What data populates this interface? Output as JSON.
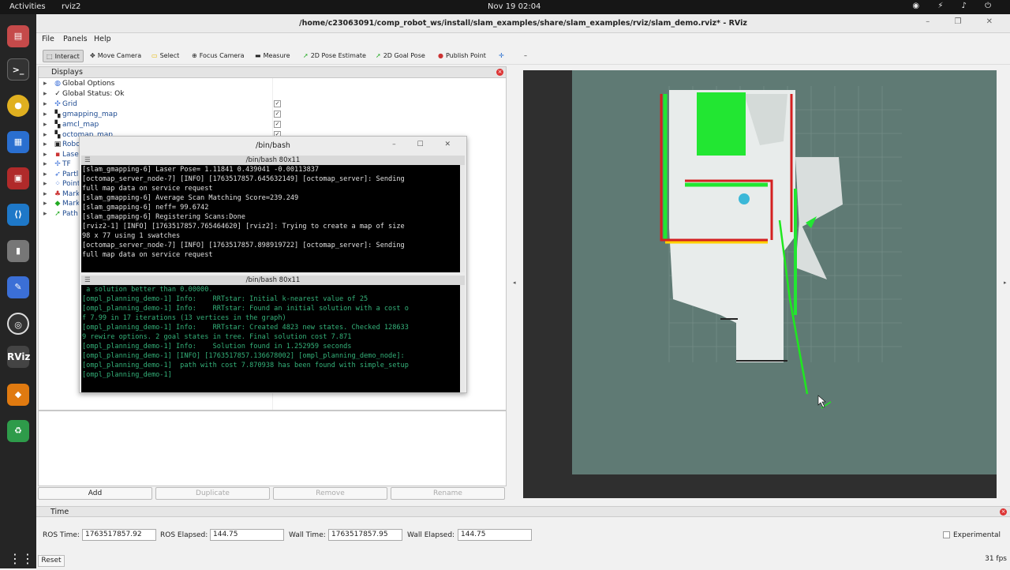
{
  "topbar": {
    "activities": "Activities",
    "app_name": "rviz2",
    "clock": "Nov 19  02:04"
  },
  "window": {
    "title": "/home/c23063091/comp_robot_ws/install/slam_examples/share/slam_examples/rviz/slam_demo.rviz* - RViz"
  },
  "menu": {
    "file": "File",
    "panels": "Panels",
    "help": "Help"
  },
  "toolbar": {
    "interact": "Interact",
    "move_camera": "Move Camera",
    "select": "Select",
    "focus_camera": "Focus Camera",
    "measure": "Measure",
    "pose_estimate": "2D Pose Estimate",
    "goal_pose": "2D Goal Pose",
    "publish_point": "Publish Point"
  },
  "displays": {
    "title": "Displays",
    "items": [
      {
        "label": "Global Options"
      },
      {
        "label": "Global Status: Ok"
      },
      {
        "label": "Grid",
        "checked": true
      },
      {
        "label": "gmapping_map",
        "checked": true
      },
      {
        "label": "amcl_map",
        "checked": true
      },
      {
        "label": "octomap_map",
        "checked": true
      },
      {
        "label": "Robo"
      },
      {
        "label": "Laser"
      },
      {
        "label": "TF"
      },
      {
        "label": "Partl"
      },
      {
        "label": "Point"
      },
      {
        "label": "Mark"
      },
      {
        "label": "Mark"
      },
      {
        "label": "Path"
      }
    ],
    "buttons": {
      "add": "Add",
      "duplicate": "Duplicate",
      "remove": "Remove",
      "rename": "Rename"
    }
  },
  "terminal": {
    "title": "/bin/bash",
    "pane1": {
      "title": "/bin/bash 80x11",
      "lines": [
        "[slam_gmapping-6] Laser Pose= 1.11841 0.439041 -0.00113837",
        "[octomap_server_node-7] [INFO] [1763517857.645632149] [octomap_server]: Sending",
        "full map data on service request",
        "[slam_gmapping-6] Average Scan Matching Score=239.249",
        "[slam_gmapping-6] neff= 99.6742",
        "[slam_gmapping-6] Registering Scans:Done",
        "[rviz2-1] [INFO] [1763517857.765464620] [rviz2]: Trying to create a map of size",
        "98 x 77 using 1 swatches",
        "[octomap_server_node-7] [INFO] [1763517857.898919722] [octomap_server]: Sending",
        "full map data on service request",
        ""
      ]
    },
    "pane2": {
      "title": "/bin/bash 80x11",
      "lines": [
        " a solution better than 0.00000.",
        "[ompl_planning_demo-1] Info:    RRTstar: Initial k-nearest value of 25",
        "[ompl_planning_demo-1] Info:    RRTstar: Found an initial solution with a cost o",
        "f 7.99 in 17 iterations (13 vertices in the graph)",
        "[ompl_planning_demo-1] Info:    RRTstar: Created 4823 new states. Checked 128633",
        "9 rewire options. 2 goal states in tree. Final solution cost 7.871",
        "[ompl_planning_demo-1] Info:    Solution found in 1.252959 seconds",
        "[ompl_planning_demo-1] [INFO] [1763517857.136678002] [ompl_planning_demo_node]:",
        "[ompl_planning_demo-1]  path with cost 7.870938 has been found with simple_setup",
        "[ompl_planning_demo-1]",
        ""
      ]
    }
  },
  "time": {
    "title": "Time",
    "ros_time_label": "ROS Time:",
    "ros_time": "1763517857.92",
    "ros_elapsed_label": "ROS Elapsed:",
    "ros_elapsed": "144.75",
    "wall_time_label": "Wall Time:",
    "wall_time": "1763517857.95",
    "wall_elapsed_label": "Wall Elapsed:",
    "wall_elapsed": "144.75",
    "experimental": "Experimental",
    "reset": "Reset",
    "fps": "31 fps"
  },
  "colors": {
    "map_bg": "#5f7a74",
    "occupancy_green": "#22e632",
    "path": "#1fe81f"
  }
}
